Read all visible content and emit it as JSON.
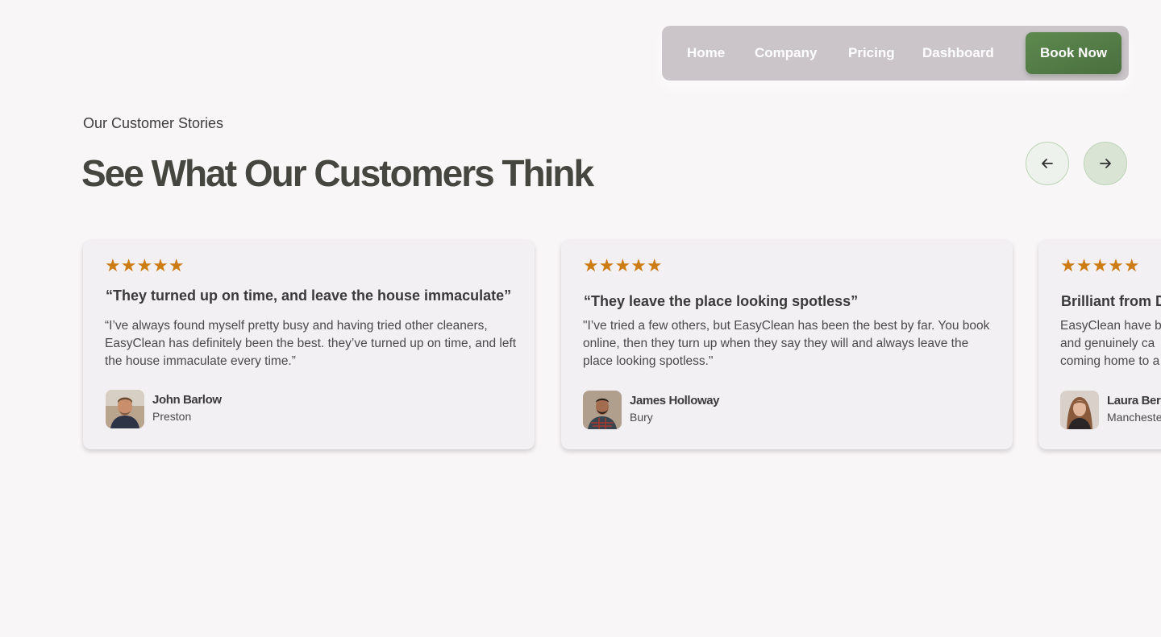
{
  "nav": {
    "items": [
      {
        "label": "Home"
      },
      {
        "label": "Company"
      },
      {
        "label": "Pricing"
      },
      {
        "label": "Dashboard"
      }
    ],
    "cta_label": "Book Now"
  },
  "section": {
    "eyebrow": "Our Customer Stories",
    "title": "See What Our Customers Think",
    "prev_icon": "arrow-left-icon",
    "next_icon": "arrow-right-icon"
  },
  "testimonials": [
    {
      "stars": "★★★★★",
      "rating": 5,
      "title": "“They turned up on time, and leave the house immaculate”",
      "body": "“I’ve always found myself pretty busy and having tried other cleaners, EasyClean has definitely been the best. they’ve turned up on time, and left the house immaculate every time.”",
      "name": "John Barlow",
      "location": "Preston"
    },
    {
      "stars": "★★★★★",
      "rating": 5,
      "title": "“They leave the place looking spotless”",
      "body": "\"I’ve tried a few others, but EasyClean has been the best by far. You book online, then they turn up when they say they will and always leave the place looking spotless.\"",
      "name": "James Holloway",
      "location": "Bury"
    },
    {
      "stars": "★★★★★",
      "rating": 5,
      "title": "Brilliant from D",
      "body": "EasyClean have b and genuinely ca coming home to a",
      "name": "Laura Ber",
      "location": "Mancheste"
    }
  ],
  "colors": {
    "accent": "#5b8a4d",
    "star": "#cc7c12",
    "nav_bg": "#cbc5c9",
    "heading": "#44463f"
  }
}
